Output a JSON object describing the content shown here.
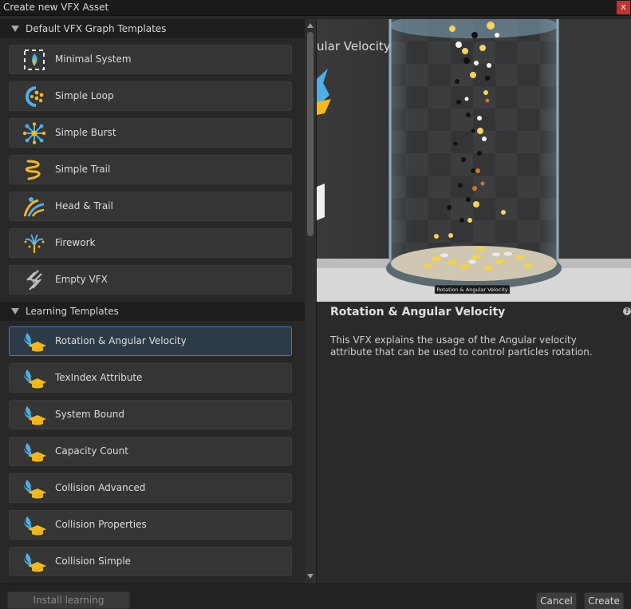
{
  "window": {
    "title": "Create new VFX Asset",
    "close_label": "x"
  },
  "sections": [
    {
      "title": "Default VFX Graph Templates",
      "items": [
        {
          "label": "Minimal System",
          "icon": "minimal-system-icon"
        },
        {
          "label": "Simple Loop",
          "icon": "simple-loop-icon"
        },
        {
          "label": "Simple Burst",
          "icon": "simple-burst-icon"
        },
        {
          "label": "Simple Trail",
          "icon": "simple-trail-icon"
        },
        {
          "label": "Head & Trail",
          "icon": "head-trail-icon"
        },
        {
          "label": "Firework",
          "icon": "firework-icon"
        },
        {
          "label": "Empty VFX",
          "icon": "empty-vfx-icon"
        }
      ]
    },
    {
      "title": "Learning Templates",
      "items": [
        {
          "label": "Rotation & Angular Velocity",
          "icon": "learning-template-icon"
        },
        {
          "label": "TexIndex Attribute",
          "icon": "learning-template-icon"
        },
        {
          "label": "System Bound",
          "icon": "learning-template-icon"
        },
        {
          "label": "Capacity Count",
          "icon": "learning-template-icon"
        },
        {
          "label": "Collision Advanced",
          "icon": "learning-template-icon"
        },
        {
          "label": "Collision Properties",
          "icon": "learning-template-icon"
        },
        {
          "label": "Collision Simple",
          "icon": "learning-template-icon"
        }
      ]
    }
  ],
  "selected": "Rotation & Angular Velocity",
  "preview": {
    "overlay_text": "ular Velocity",
    "plate_label": "Rotation & Angular Velocity"
  },
  "detail": {
    "title": "Rotation & Angular Velocity",
    "help_label": "?",
    "description": "This VFX explains the usage of the Angular velocity attribute that can be used to control particles rotation."
  },
  "footer": {
    "install_label": "Install learning templates",
    "cancel_label": "Cancel",
    "create_label": "Create"
  },
  "colors": {
    "accent_blue": "#4f7aa8",
    "icon_blue": "#4fb0e8",
    "icon_yellow": "#f2b81e",
    "close_red": "#c8302a"
  }
}
